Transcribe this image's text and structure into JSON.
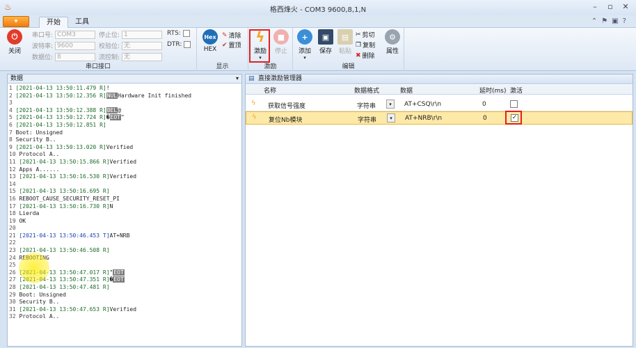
{
  "window": {
    "title": "格西烽火 - COM3  9600,8,1,N"
  },
  "tabs": {
    "app_menu": "▾",
    "start": "开始",
    "tools": "工具"
  },
  "ribbon": {
    "serial": {
      "label": "串口接口",
      "close_label": "关闭",
      "port_label": "串口号:",
      "port_value": "COM3",
      "baud_label": "波特率:",
      "baud_value": "9600",
      "databits_label": "数据位:",
      "databits_value": "8",
      "stopbits_label": "停止位:",
      "stopbits_value": "1",
      "parity_label": "校验位:",
      "parity_value": "无",
      "flow_label": "流控制:",
      "flow_value": "无",
      "rts_label": "RTS:",
      "dtr_label": "DTR:"
    },
    "display": {
      "label": "显示",
      "hex_label": "HEX",
      "hex_icon_text": "Hex",
      "clear_label": "清除",
      "top_label": "置顶"
    },
    "stimulus": {
      "label": "激励",
      "stimulate_label": "激励",
      "stop_label": "停止"
    },
    "edit": {
      "label": "编辑",
      "add_label": "添加",
      "save_label": "保存",
      "paste_label": "粘贴",
      "cut_label": "剪切",
      "copy_label": "复制",
      "delete_label": "删除",
      "props_label": "属性"
    }
  },
  "data_panel": {
    "title": "数据"
  },
  "stim_panel": {
    "title": "直接激励管理器",
    "columns": {
      "name": "名称",
      "format": "数据格式",
      "data": "数据",
      "delay": "延时(ms)",
      "active": "激活"
    },
    "rows": [
      {
        "name": "获取信号强度",
        "format": "字符串",
        "data": "AT+CSQ\\r\\n",
        "delay": "0",
        "active": false
      },
      {
        "name": "复位Nb模块",
        "format": "字符串",
        "data": "AT+NRB\\r\\n",
        "delay": "0",
        "active": true
      }
    ]
  },
  "log": [
    {
      "n": "1",
      "ts": "[2021-04-13 13:50:11.479 R]",
      "t": "!",
      "tag": ""
    },
    {
      "n": "2",
      "ts": "[2021-04-13 13:50:12.356 R]",
      "t": "Hardware Init finished",
      "tag": "NUL",
      "tagfirst": true
    },
    {
      "n": "3",
      "ts": "",
      "t": "",
      "tag": ""
    },
    {
      "n": "4",
      "ts": "[2021-04-13 13:50:12.388 R]",
      "t": "@",
      "tag": "BEL",
      "tagfirst": true
    },
    {
      "n": "5",
      "ts": "[2021-04-13 13:50:12.724 R]",
      "t": "�",
      "tag": "EOT",
      "tagafter": "\""
    },
    {
      "n": "6",
      "ts": "[2021-04-13 13:50:12.851 R]",
      "t": "",
      "tag": ""
    },
    {
      "n": "7",
      "ts": "",
      "t": "Boot: Unsigned",
      "tag": ""
    },
    {
      "n": "8",
      "ts": "",
      "t": "Security B..",
      "tag": ""
    },
    {
      "n": "9",
      "ts": "[2021-04-13 13:50:13.020 R]",
      "t": "Verified",
      "tag": ""
    },
    {
      "n": "10",
      "ts": "",
      "t": "Protocol A..",
      "tag": ""
    },
    {
      "n": "11",
      "ts": "[2021-04-13 13:50:15.866 R]",
      "t": "Verified",
      "tag": ""
    },
    {
      "n": "12",
      "ts": "",
      "t": "Apps A......",
      "tag": ""
    },
    {
      "n": "13",
      "ts": "[2021-04-13 13:50:16.530 R]",
      "t": "Verified",
      "tag": ""
    },
    {
      "n": "14",
      "ts": "",
      "t": "",
      "tag": ""
    },
    {
      "n": "15",
      "ts": "[2021-04-13 13:50:16.695 R]",
      "t": "",
      "tag": ""
    },
    {
      "n": "16",
      "ts": "",
      "t": "REBOOT_CAUSE_SECURITY_RESET_PI",
      "tag": ""
    },
    {
      "n": "17",
      "ts": "[2021-04-13 13:50:16.730 R]",
      "t": "N",
      "tag": ""
    },
    {
      "n": "18",
      "ts": "",
      "t": "Lierda",
      "tag": ""
    },
    {
      "n": "19",
      "ts": "",
      "t": "OK",
      "tag": ""
    },
    {
      "n": "20",
      "ts": "",
      "t": "",
      "tag": ""
    },
    {
      "n": "21",
      "ts": "[2021-04-13 13:50:46.453 T]",
      "t": "AT+NRB",
      "tag": "",
      "tx": true
    },
    {
      "n": "22",
      "ts": "",
      "t": "",
      "tag": ""
    },
    {
      "n": "23",
      "ts": "[2021-04-13 13:50:46.508 R]",
      "t": "",
      "tag": ""
    },
    {
      "n": "24",
      "ts": "",
      "t": "REBOOTING",
      "tag": ""
    },
    {
      "n": "25",
      "ts": "",
      "t": "",
      "tag": ""
    },
    {
      "n": "26",
      "ts": "[2021-04-13 13:50:47.017 R]",
      "t": "\"",
      "tag": "EOT"
    },
    {
      "n": "27",
      "ts": "[2021-04-13 13:50:47.351 R]",
      "t": "�",
      "tag": "EOT"
    },
    {
      "n": "28",
      "ts": "[2021-04-13 13:50:47.481 R]",
      "t": "",
      "tag": ""
    },
    {
      "n": "29",
      "ts": "",
      "t": "Boot: Unsigned",
      "tag": ""
    },
    {
      "n": "30",
      "ts": "",
      "t": "Security B..",
      "tag": ""
    },
    {
      "n": "31",
      "ts": "[2021-04-13 13:50:47.653 R]",
      "t": "Verified",
      "tag": ""
    },
    {
      "n": "32",
      "ts": "",
      "t": "Protocol A..",
      "tag": ""
    }
  ]
}
